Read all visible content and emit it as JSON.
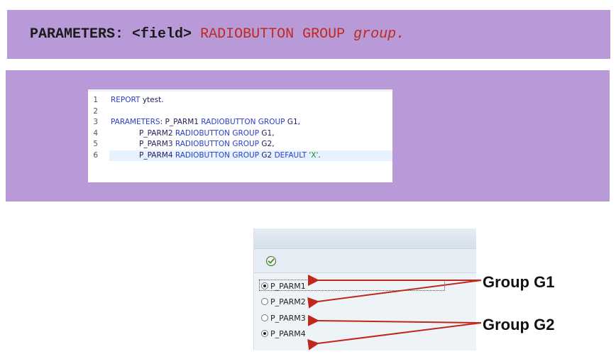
{
  "syntax": {
    "keyword": "PARAMETERS:",
    "field": "<field>",
    "radiobutton_group": "RADIOBUTTON GROUP",
    "group": "group."
  },
  "code": {
    "line_numbers": [
      "1",
      "2",
      "3",
      "4",
      "5",
      "6"
    ],
    "lines": [
      {
        "parts": [
          [
            "kw",
            "REPORT"
          ],
          [
            "id",
            " ytest."
          ]
        ]
      },
      {
        "parts": []
      },
      {
        "parts": [
          [
            "kw",
            "PARAMETERS"
          ],
          [
            "id",
            ": P_PARM1 "
          ],
          [
            "kw",
            "RADIOBUTTON GROUP"
          ],
          [
            "id",
            " G1,"
          ]
        ]
      },
      {
        "parts": [
          [
            "id",
            "            P_PARM2 "
          ],
          [
            "kw",
            "RADIOBUTTON GROUP"
          ],
          [
            "id",
            " G1,"
          ]
        ]
      },
      {
        "parts": [
          [
            "id",
            "            P_PARM3 "
          ],
          [
            "kw",
            "RADIOBUTTON GROUP"
          ],
          [
            "id",
            " G2,"
          ]
        ]
      },
      {
        "parts": [
          [
            "id",
            "            P_PARM4 "
          ],
          [
            "kw",
            "RADIOBUTTON GROUP"
          ],
          [
            "id",
            " G2 "
          ],
          [
            "kw",
            "DEFAULT"
          ],
          [
            "id",
            " "
          ],
          [
            "str",
            "'X'"
          ],
          [
            "id",
            "."
          ]
        ]
      }
    ]
  },
  "selection_screen": {
    "radios": [
      {
        "label": "P_PARM1",
        "selected": true
      },
      {
        "label": "P_PARM2",
        "selected": false
      },
      {
        "label": "P_PARM3",
        "selected": false
      },
      {
        "label": "P_PARM4",
        "selected": true
      }
    ]
  },
  "annotations": {
    "group1": "Group G1",
    "group2": "Group G2",
    "arrow_color": "#c0281c"
  },
  "icons": {
    "execute": "execute-icon"
  },
  "colors": {
    "banner": "#b99ad8",
    "keyword_red": "#c0281c",
    "abap_keyword": "#2a3ec9",
    "abap_string": "#1d8f1d"
  }
}
